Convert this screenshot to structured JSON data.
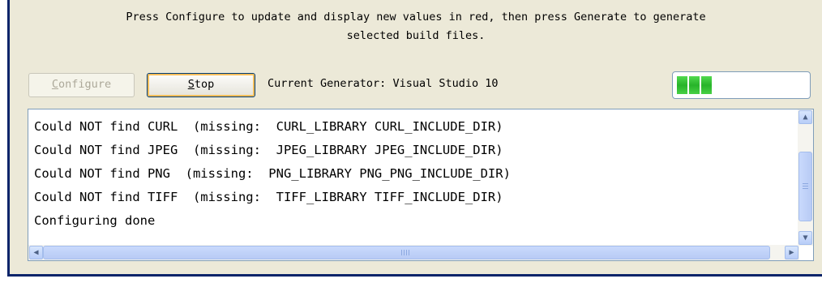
{
  "info_text": "Press Configure to update and display new values in red, then press Generate to generate\nselected build files.",
  "toolbar": {
    "configure_hotkey": "C",
    "configure_rest": "onfigure",
    "stop_hotkey": "S",
    "stop_rest": "top",
    "generator_prefix": "Current Generator:",
    "generator_value": "Visual Studio 10",
    "progress_fraction": 0.31
  },
  "log": {
    "lines": [
      "Could NOT find CURL  (missing:  CURL_LIBRARY CURL_INCLUDE_DIR)",
      "Could NOT find JPEG  (missing:  JPEG_LIBRARY JPEG_INCLUDE_DIR)",
      "Could NOT find PNG  (missing:  PNG_LIBRARY PNG_PNG_INCLUDE_DIR)",
      "Could NOT find TIFF  (missing:  TIFF_LIBRARY TIFF_INCLUDE_DIR)",
      "Configuring done"
    ]
  },
  "icons": {
    "scroll_up": "arrow-up-icon",
    "scroll_down": "arrow-down-icon",
    "scroll_left": "arrow-left-icon",
    "scroll_right": "arrow-right-icon"
  },
  "colors": {
    "progress_green": "#28b42a",
    "disabled_text": "#aca899",
    "focus_border": "#f6be5b"
  }
}
